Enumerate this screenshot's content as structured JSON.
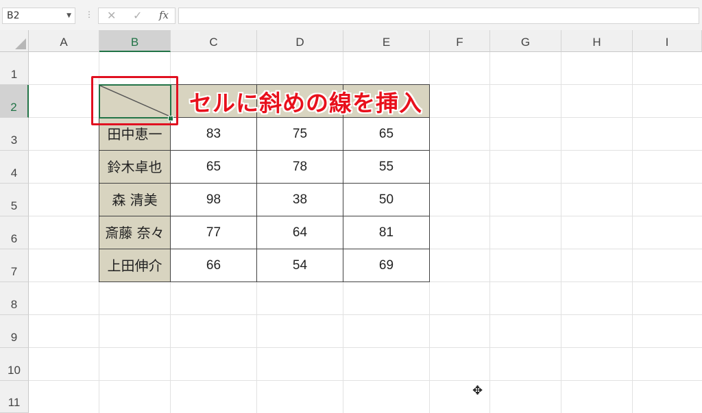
{
  "formula_bar": {
    "name_box": "B2",
    "cancel_icon": "✕",
    "enter_icon": "✓",
    "fx_label": "fx",
    "formula": ""
  },
  "columns": [
    "A",
    "B",
    "C",
    "D",
    "E",
    "F",
    "G",
    "H",
    "I"
  ],
  "rows": [
    "1",
    "2",
    "3",
    "4",
    "5",
    "6",
    "7",
    "8",
    "9",
    "10",
    "11"
  ],
  "table": {
    "names": [
      "田中恵一",
      "鈴木卓也",
      "森 清美",
      "斎藤 奈々",
      "上田伸介"
    ],
    "values": [
      [
        "83",
        "75",
        "65"
      ],
      [
        "65",
        "78",
        "55"
      ],
      [
        "98",
        "38",
        "50"
      ],
      [
        "77",
        "64",
        "81"
      ],
      [
        "66",
        "54",
        "69"
      ]
    ]
  },
  "annotation": {
    "banner_text": "セルに斜めの線を挿入",
    "highlight_color": "#e01020"
  },
  "colors": {
    "accent": "#217346",
    "header_fill": "#d8d4c0"
  },
  "icons": {
    "cursor": "move-cross-icon"
  }
}
